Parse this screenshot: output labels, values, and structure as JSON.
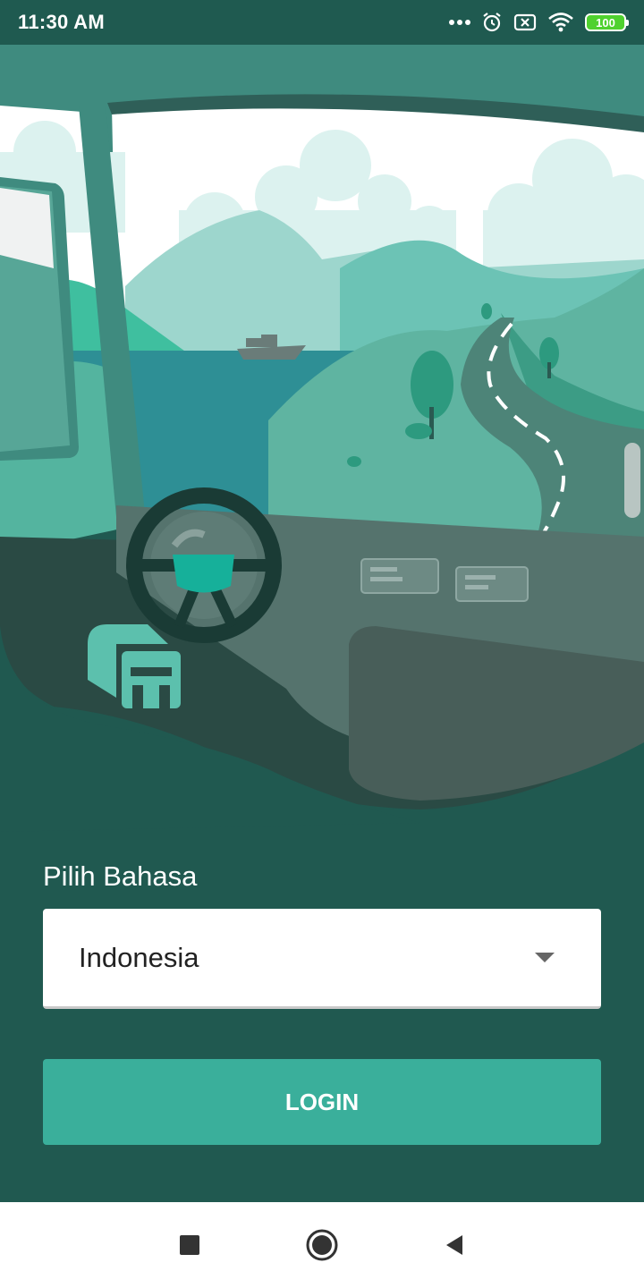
{
  "status_bar": {
    "time": "11:30 AM",
    "battery_level": "100",
    "icons": [
      "more-dots-icon",
      "alarm-icon",
      "sim-off-icon",
      "wifi-icon",
      "battery-icon"
    ]
  },
  "hero": {
    "illustration": "truck-cab-view-illustration",
    "logo_icon": "truck-app-logo-icon"
  },
  "form": {
    "language_label": "Pilih Bahasa",
    "language_selected": "Indonesia",
    "login_label": "LOGIN"
  },
  "nav_bar": {
    "icons": [
      "recents-square-icon",
      "home-circle-icon",
      "back-triangle-icon"
    ]
  },
  "colors": {
    "background": "#205950",
    "accent": "#3aaf9b",
    "status_bar": "#1f5a50",
    "battery": "#4fd12f"
  }
}
